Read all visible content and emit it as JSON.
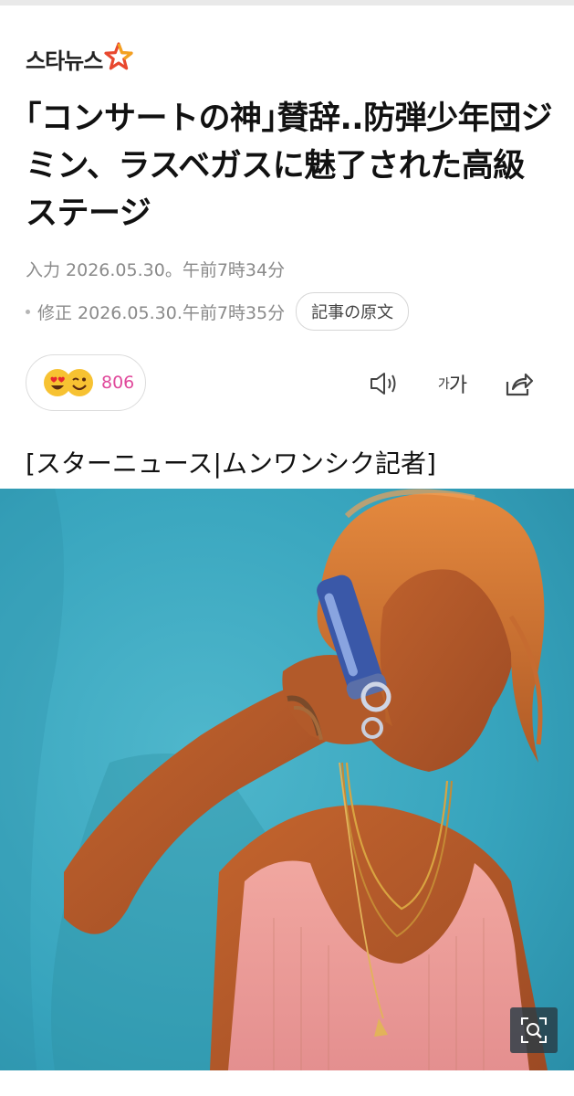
{
  "brand": {
    "logo_text": "스타뉴스",
    "star_color": "#e8482f"
  },
  "article": {
    "headline": "｢コンサートの神｣賛辞..防弾少年団ジミン、ラスベガスに魅了された高級ステージ",
    "input_date": "入力 2026.05.30。午前7時34分",
    "modified_date": "修正 2026.05.30.午前7時35分",
    "original_button": "記事の原文",
    "byline": "[スターニュース|ムンワンシク記者]"
  },
  "reactions": {
    "count": "806",
    "count_color": "#e0499b",
    "emojis": [
      "heart-eyes-emoji",
      "wink-emoji"
    ]
  },
  "toolbar": {
    "font_small": "가",
    "font_big": "가",
    "icons": [
      "speaker-icon",
      "font-size-icon",
      "share-icon"
    ]
  },
  "photo": {
    "zoom_icon": "zoom-search-icon"
  }
}
